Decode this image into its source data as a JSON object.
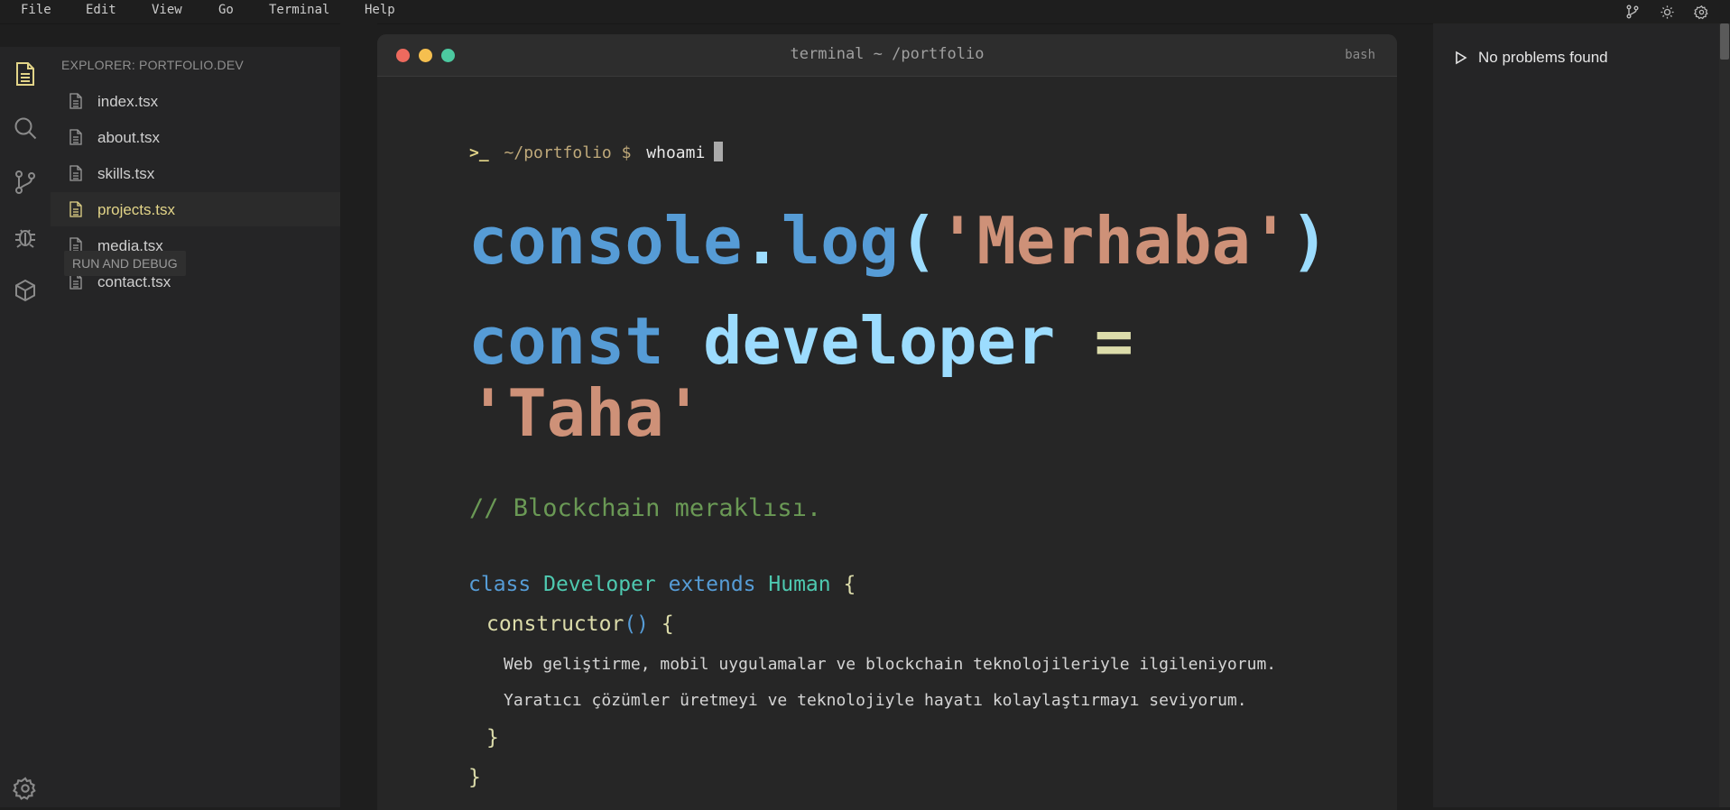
{
  "menubar": {
    "items": [
      "File",
      "Edit",
      "View",
      "Go",
      "Terminal",
      "Help"
    ],
    "right_icons": [
      "git-branch-icon",
      "sun-icon",
      "gear-icon"
    ]
  },
  "activitybar": {
    "icons": [
      "files-icon",
      "search-icon",
      "source-control-icon",
      "debug-icon",
      "extensions-icon",
      "settings-gear-icon"
    ]
  },
  "explorer": {
    "title": "EXPLORER: PORTFOLIO.DEV",
    "files": [
      "index.tsx",
      "about.tsx",
      "skills.tsx",
      "projects.tsx",
      "media.tsx",
      "contact.tsx"
    ],
    "active_file": "projects.tsx",
    "tooltip": "RUN AND DEBUG"
  },
  "terminal": {
    "title": "terminal ~ /portfolio",
    "shell": "bash",
    "prompt_symbol": ">_",
    "prompt_path": "~/portfolio $",
    "command": "whoami",
    "console_line": {
      "obj": "console",
      "dot": ".",
      "method": "log",
      "open": "(",
      "arg": "'Merhaba'",
      "close": ")"
    },
    "const_line": {
      "keyword": "const",
      "name": "developer",
      "eq": "=",
      "value": "'Taha'"
    },
    "comment": "// Blockchain meraklısı.",
    "class_line": {
      "kw_class": "class",
      "class_name": "Developer",
      "kw_extends": "extends",
      "parent": "Human",
      "brace": "{"
    },
    "constructor_line": {
      "name": "constructor",
      "parens": "()",
      "brace": "{"
    },
    "body_lines": [
      "Web geliştirme, mobil uygulamalar ve blockchain teknolojileriyle ilgileniyorum.",
      "Yaratıcı çözümler üretmeyi ve teknolojiyle hayatı kolaylaştırmayı seviyorum."
    ],
    "inner_close": "}",
    "outer_close": "}"
  },
  "problems": {
    "text": "No problems found"
  },
  "colors": {
    "keyword_blue": "#569cd6",
    "variable_lightblue": "#9cdcfe",
    "string_orange": "#ce9178",
    "type_teal": "#4ec9b0",
    "function_yellow": "#dcdcaa",
    "comment_green": "#6a9955",
    "active_file_yellow": "#e2d488"
  }
}
